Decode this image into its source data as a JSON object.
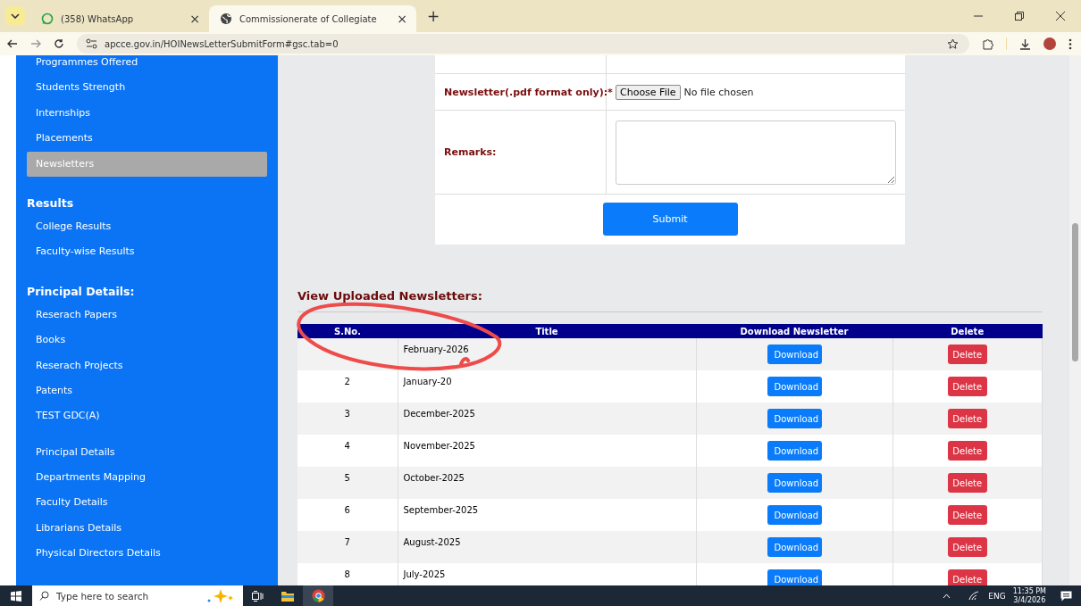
{
  "browser": {
    "tabs": [
      {
        "title": "(358) WhatsApp",
        "kind": "whatsapp",
        "selected": false,
        "close": "×"
      },
      {
        "title": "Commissionerate of Collegiate",
        "kind": "globe",
        "selected": true,
        "close": "×"
      }
    ],
    "new_tab": "+",
    "url": "apcce.gov.in/HOINewsLetterSubmitForm#gsc.tab=0"
  },
  "sidebar": [
    {
      "kind": "item",
      "label": "Programmes Offered",
      "selected": false
    },
    {
      "kind": "item",
      "label": "Students Strength",
      "selected": false
    },
    {
      "kind": "item",
      "label": "Internships",
      "selected": false
    },
    {
      "kind": "item",
      "label": "Placements",
      "selected": false
    },
    {
      "kind": "item",
      "label": "Newsletters",
      "selected": true
    },
    {
      "kind": "heading",
      "label": "Results"
    },
    {
      "kind": "item",
      "label": "College Results",
      "selected": false
    },
    {
      "kind": "item",
      "label": "Faculty-wise Results",
      "selected": false
    },
    {
      "kind": "heading",
      "label": "Principal Details:"
    },
    {
      "kind": "item",
      "label": "Reserach Papers",
      "selected": false
    },
    {
      "kind": "item",
      "label": "Books",
      "selected": false
    },
    {
      "kind": "item",
      "label": "Reserach Projects",
      "selected": false
    },
    {
      "kind": "item",
      "label": "Patents",
      "selected": false
    },
    {
      "kind": "item",
      "label": "TEST GDC(A)",
      "selected": false
    },
    {
      "kind": "item",
      "label": "Principal Details",
      "selected": false
    },
    {
      "kind": "item",
      "label": "Departments Mapping",
      "selected": false
    },
    {
      "kind": "item",
      "label": "Faculty Details",
      "selected": false
    },
    {
      "kind": "item",
      "label": "Librarians Details",
      "selected": false
    },
    {
      "kind": "item",
      "label": "Physical Directors Details",
      "selected": false
    }
  ],
  "form": {
    "file_label": "Newsletter(.pdf format only):*",
    "file_button": "Choose File",
    "file_status": "No file chosen",
    "remarks_label": "Remarks:",
    "submit": "Submit"
  },
  "newsletters": {
    "heading": "View Uploaded Newsletters:",
    "columns": [
      "S.No.",
      "Title",
      "Download Newsletter",
      "Delete"
    ],
    "rows": [
      {
        "title": "February-2026",
        "download": "Download",
        "delete": "Delete"
      },
      {
        "sno": "2",
        "title": "January-20",
        "download": "Download",
        "delete": "Delete"
      },
      {
        "sno": "3",
        "title": "December-2025",
        "download": "Download",
        "delete": "Delete"
      },
      {
        "sno": "4",
        "title": "November-2025",
        "download": "Download",
        "delete": "Delete"
      },
      {
        "sno": "5",
        "title": "October-2025",
        "download": "Download",
        "delete": "Delete"
      },
      {
        "sno": "6",
        "title": "September-2025",
        "download": "Download",
        "delete": "Delete"
      },
      {
        "sno": "7",
        "title": "August-2025",
        "download": "Download",
        "delete": "Delete"
      },
      {
        "sno": "8",
        "title": "July-2025",
        "download": "Download",
        "delete": "Delete"
      }
    ]
  },
  "taskbar": {
    "search_placeholder": "Type here to search",
    "language": "ENG",
    "time": "11:35 PM",
    "date": "3/4/2026"
  }
}
